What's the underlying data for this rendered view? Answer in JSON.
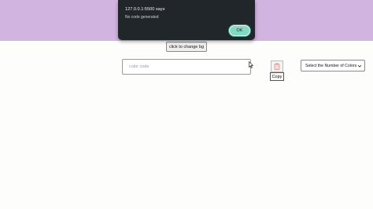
{
  "page": {
    "background_color": "#fdfdfc",
    "band_color": "#d2b4e0"
  },
  "controls": {
    "change_bg_label": "click to change bg",
    "color_input_placeholder": "color code",
    "copy_label": "Copy",
    "copy_icon": "clipboard-icon",
    "select_label": "Select the Number of Colors"
  },
  "alert": {
    "title": "127.0.0.1:5500 says",
    "message": "No code generated",
    "ok_label": "OK",
    "accent_color": "#8ad6c4"
  }
}
